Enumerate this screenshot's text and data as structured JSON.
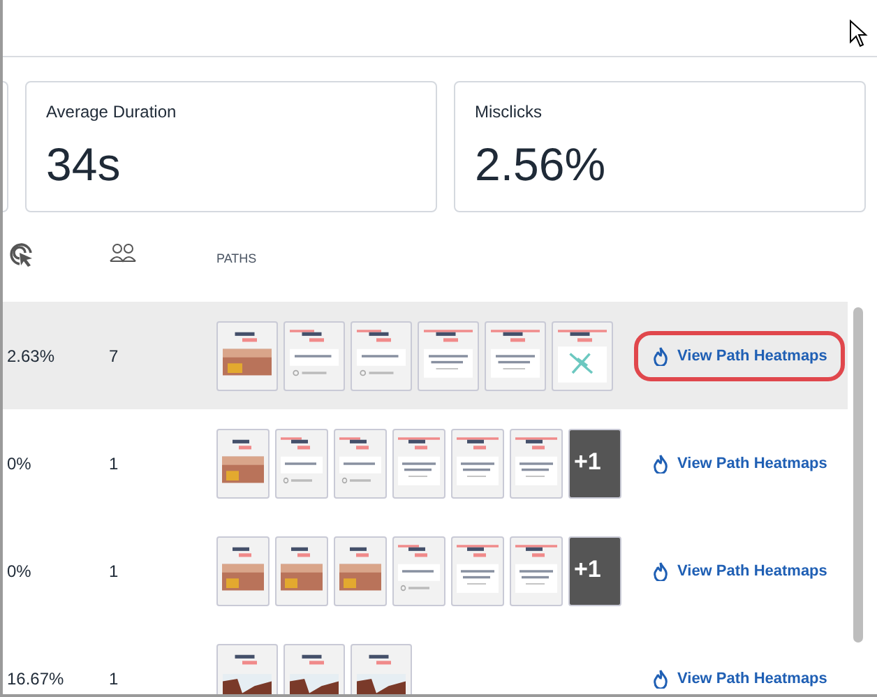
{
  "metrics": [
    {
      "label": "Average Duration",
      "value": "34s"
    },
    {
      "label": "Misclicks",
      "value": "2.56%"
    }
  ],
  "table": {
    "columns": [
      {
        "kind": "misclick-icon"
      },
      {
        "kind": "users-icon"
      },
      {
        "kind": "text",
        "label": "PATHS"
      }
    ],
    "rows": [
      {
        "misclick_rate": "2.63%",
        "users": "7",
        "selected": true,
        "button": {
          "label": "View Path Heatmaps",
          "outlined": true
        },
        "thumbnails": [
          {
            "kind": "photo"
          },
          {
            "kind": "question"
          },
          {
            "kind": "question"
          },
          {
            "kind": "choice"
          },
          {
            "kind": "choice"
          },
          {
            "kind": "done"
          }
        ]
      },
      {
        "misclick_rate": "0%",
        "users": "1",
        "selected": false,
        "button": {
          "label": "View Path Heatmaps",
          "outlined": false
        },
        "thumbnails": [
          {
            "kind": "photo"
          },
          {
            "kind": "question"
          },
          {
            "kind": "question"
          },
          {
            "kind": "choice"
          },
          {
            "kind": "choice"
          },
          {
            "kind": "choice"
          },
          {
            "kind": "more",
            "label": "+1"
          }
        ]
      },
      {
        "misclick_rate": "0%",
        "users": "1",
        "selected": false,
        "button": {
          "label": "View Path Heatmaps",
          "outlined": false
        },
        "thumbnails": [
          {
            "kind": "photo"
          },
          {
            "kind": "photo"
          },
          {
            "kind": "photo"
          },
          {
            "kind": "question"
          },
          {
            "kind": "choice"
          },
          {
            "kind": "choice"
          },
          {
            "kind": "more",
            "label": "+1"
          }
        ]
      },
      {
        "misclick_rate": "16.67%",
        "users": "1",
        "selected": false,
        "button": {
          "label": "View Path Heatmaps",
          "outlined": false
        },
        "thumbnails": [
          {
            "kind": "cliff"
          },
          {
            "kind": "cliff"
          },
          {
            "kind": "cliff"
          }
        ]
      }
    ]
  }
}
